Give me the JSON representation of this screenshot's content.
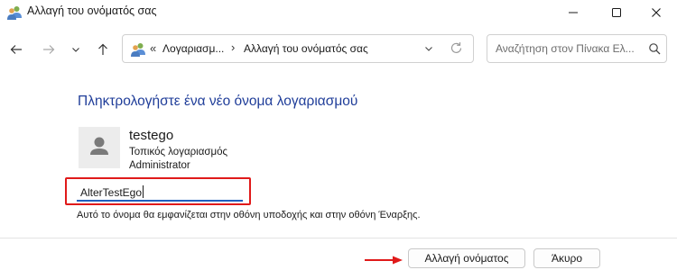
{
  "window": {
    "title": "Αλλαγή του ονόματός σας",
    "app_icon": "users-icon"
  },
  "address_bar": {
    "overflow": "«",
    "crumbs": [
      "Λογαριασμ...",
      "Αλλαγή του ονόματός σας"
    ],
    "separator": "›"
  },
  "search": {
    "placeholder": "Αναζήτηση στον Πίνακα Ελ..."
  },
  "main": {
    "heading": "Πληκτρολογήστε ένα νέο όνομα λογαριασμού",
    "account": {
      "name": "testego",
      "type": "Τοπικός λογαριασμός",
      "role": "Administrator"
    },
    "new_name_value": "AlterTestEgo",
    "hint": "Αυτό το όνομα θα εμφανίζεται στην οθόνη υποδοχής και στην οθόνη Έναρξης."
  },
  "buttons": {
    "rename": "Αλλαγή ονόματος",
    "cancel": "Άκυρο"
  },
  "colors": {
    "heading": "#1f3d99",
    "highlight": "#e01a1a",
    "input_underline": "#1f5fbf"
  }
}
